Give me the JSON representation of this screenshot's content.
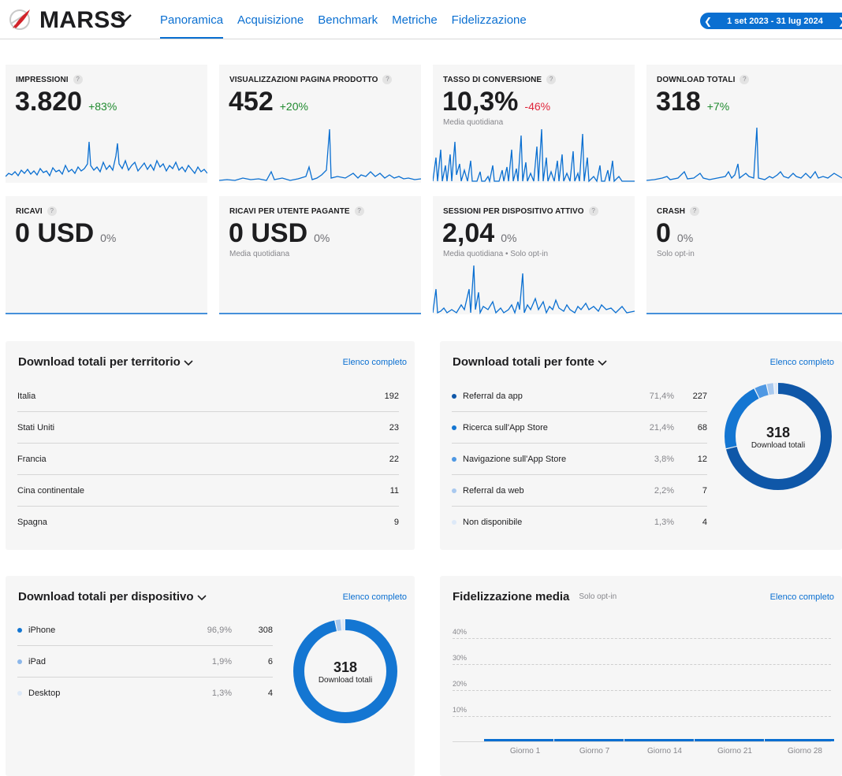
{
  "app": {
    "name": "MARSS",
    "logo_icon": "marss-rocket-logo",
    "tabs": [
      {
        "label": "Panoramica",
        "active": true
      },
      {
        "label": "Acquisizione",
        "active": false
      },
      {
        "label": "Benchmark",
        "active": false
      },
      {
        "label": "Metriche",
        "active": false
      },
      {
        "label": "Fidelizzazione",
        "active": false
      }
    ],
    "date_range": "1 set 2023 - 31 lug 2024"
  },
  "colors": {
    "accent": "#0a6fd1",
    "positive": "#1f8a2e",
    "negative": "#e0263b",
    "donut_dark": "#0f57a8",
    "donut_mid": "#1476d2",
    "donut_light": "#4f98e3",
    "donut_pale": "#a9c9ef",
    "donut_faint": "#dde9f8"
  },
  "kpis": [
    {
      "label": "IMPRESSIONI",
      "value": "3.820",
      "delta": "+83%",
      "trend": "up",
      "subtitle": ""
    },
    {
      "label": "VISUALIZZAZIONI PAGINA PRODOTTO",
      "value": "452",
      "delta": "+20%",
      "trend": "up",
      "subtitle": ""
    },
    {
      "label": "TASSO DI CONVERSIONE",
      "value": "10,3%",
      "delta": "-46%",
      "trend": "down",
      "subtitle": "Media quotidiana"
    },
    {
      "label": "DOWNLOAD TOTALI",
      "value": "318",
      "delta": "+7%",
      "trend": "up",
      "subtitle": ""
    },
    {
      "label": "RICAVI",
      "value": "0 USD",
      "delta": "0%",
      "trend": "flat",
      "subtitle": ""
    },
    {
      "label": "RICAVI PER UTENTE PAGANTE",
      "value": "0 USD",
      "delta": "0%",
      "trend": "flat",
      "subtitle": "Media quotidiana"
    },
    {
      "label": "SESSIONI PER DISPOSITIVO ATTIVO",
      "value": "2,04",
      "delta": "0%",
      "trend": "flat",
      "subtitle": "Media quotidiana • Solo opt-in"
    },
    {
      "label": "CRASH",
      "value": "0",
      "delta": "0%",
      "trend": "flat",
      "subtitle": "Solo opt-in"
    }
  ],
  "territory": {
    "title": "Download totali per territorio",
    "link": "Elenco completo",
    "rows": [
      {
        "name": "Italia",
        "value": "192"
      },
      {
        "name": "Stati Uniti",
        "value": "23"
      },
      {
        "name": "Francia",
        "value": "22"
      },
      {
        "name": "Cina continentale",
        "value": "11"
      },
      {
        "name": "Spagna",
        "value": "9"
      }
    ]
  },
  "source": {
    "title": "Download totali per fonte",
    "link": "Elenco completo",
    "rows": [
      {
        "name": "Referral da app",
        "pct": "71,4%",
        "value": "227",
        "share": 0.714
      },
      {
        "name": "Ricerca sull'App Store",
        "pct": "21,4%",
        "value": "68",
        "share": 0.214
      },
      {
        "name": "Navigazione sull'App Store",
        "pct": "3,8%",
        "value": "12",
        "share": 0.038
      },
      {
        "name": "Referral da web",
        "pct": "2,2%",
        "value": "7",
        "share": 0.022
      },
      {
        "name": "Non disponibile",
        "pct": "1,3%",
        "value": "4",
        "share": 0.013
      }
    ],
    "center_value": "318",
    "center_label": "Download totali"
  },
  "device": {
    "title": "Download totali per dispositivo",
    "link": "Elenco completo",
    "rows": [
      {
        "name": "iPhone",
        "pct": "96,9%",
        "value": "308",
        "share": 0.969
      },
      {
        "name": "iPad",
        "pct": "1,9%",
        "value": "6",
        "share": 0.019
      },
      {
        "name": "Desktop",
        "pct": "1,3%",
        "value": "4",
        "share": 0.013
      }
    ],
    "center_value": "318",
    "center_label": "Download totali"
  },
  "retention": {
    "title": "Fidelizzazione media",
    "subtitle": "Solo opt-in",
    "link": "Elenco completo",
    "y_ticks": [
      "40%",
      "30%",
      "20%",
      "10%"
    ],
    "x_ticks": [
      "Giorno 1",
      "Giorno 7",
      "Giorno 14",
      "Giorno 21",
      "Giorno 28"
    ]
  }
}
